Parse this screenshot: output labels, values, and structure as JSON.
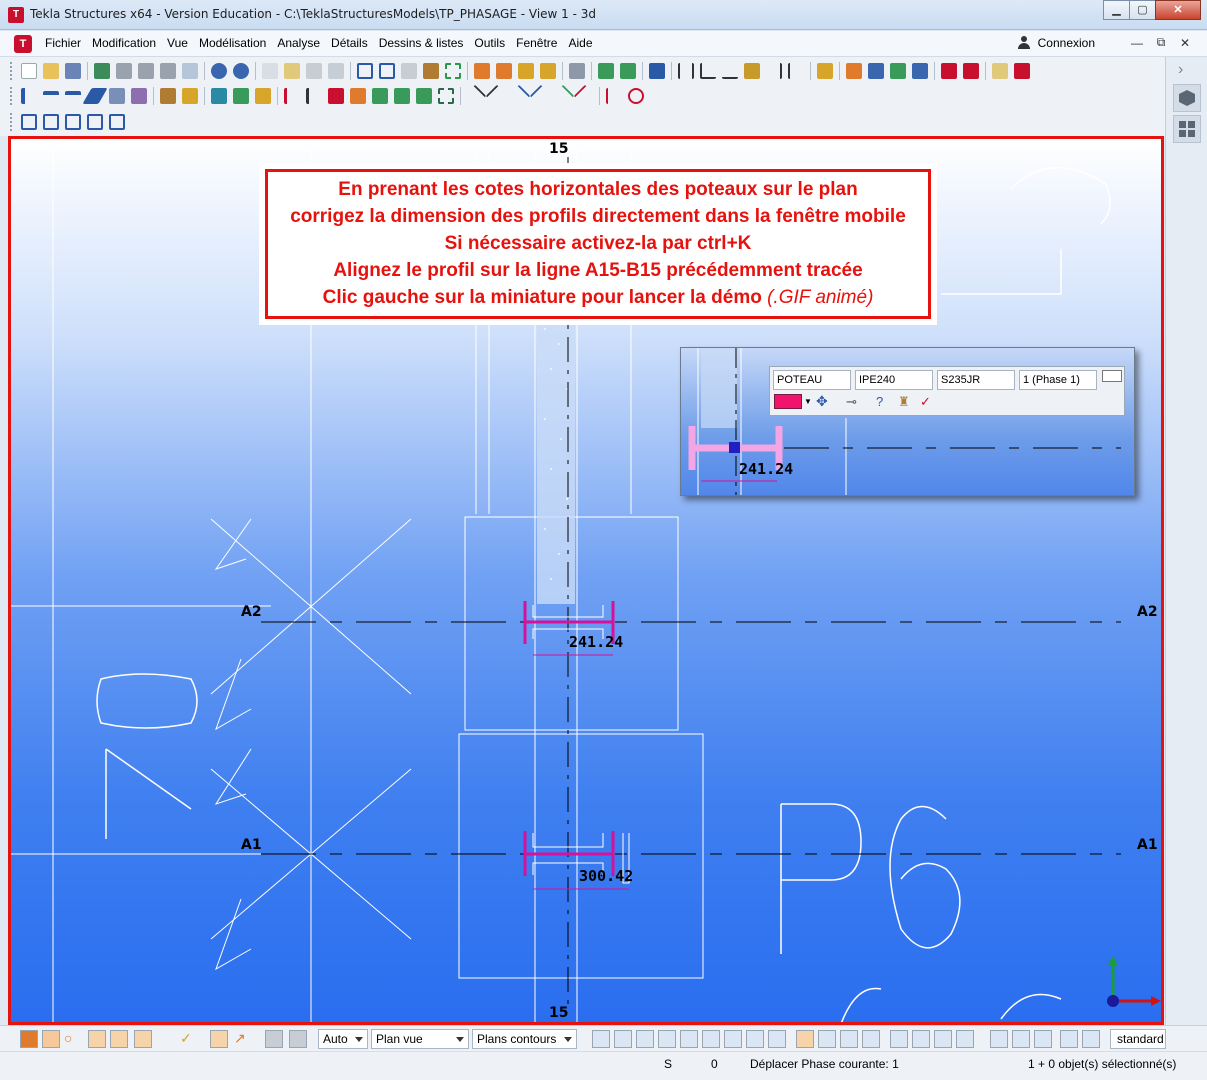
{
  "window": {
    "title": "Tekla Structures x64 - Version Education - C:\\TeklaStructuresModels\\TP_PHASAGE  - View 1 - 3d",
    "minimize": "▁",
    "maximize": "▢",
    "close": "✕"
  },
  "menu": {
    "items": [
      "Fichier",
      "Modification",
      "Vue",
      "Modélisation",
      "Analyse",
      "Détails",
      "Dessins & listes",
      "Outils",
      "Fenêtre",
      "Aide"
    ],
    "login": "Connexion",
    "mdi_minimize": "—",
    "mdi_restore": "⧉",
    "mdi_close": "✕"
  },
  "instructions": {
    "line1": "En prenant les cotes horizontales des poteaux sur le plan",
    "line2": "corrigez la dimension des profils directement dans la fenêtre mobile",
    "line3": "Si nécessaire activez-la par ctrl+K",
    "line4": "Alignez le profil sur la ligne A15-B15 précédemment tracée",
    "line5_main": "Clic gauche sur la miniature pour lancer la démo ",
    "line5_italic": "(.GIF animé)"
  },
  "viewport": {
    "grid_top": "15",
    "grid_bottom": "15",
    "grid_a2_left": "A2",
    "grid_a2_right": "A2",
    "grid_a1_left": "A1",
    "grid_a1_right": "A1",
    "dim_a2": "241.24",
    "dim_a1": "300.42",
    "dim_float": "241.24",
    "big_label_left": "76",
    "big_label_right": "P6"
  },
  "contextual_toolbar": {
    "name": "POTEAU",
    "profile": "IPE240",
    "material": "S235JR",
    "phase": "1 (Phase 1)",
    "color": "#f0146e"
  },
  "bottombar": {
    "auto": "Auto",
    "plan_vue": "Plan vue",
    "plans_contours": "Plans contours",
    "standard": "standard"
  },
  "status": {
    "s_label": "S",
    "zero": "0",
    "message": "Déplacer Phase courante: 1",
    "selection": "1 + 0 objet(s) sélectionné(s)"
  },
  "colors": {
    "accent_red": "#e5120e",
    "profile_magenta": "#d6119a",
    "viewport_blue": "#2a6ef0"
  }
}
